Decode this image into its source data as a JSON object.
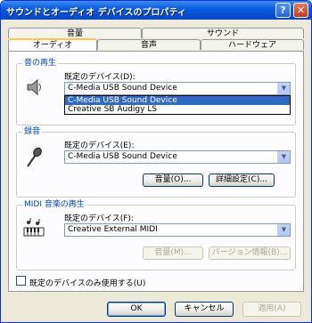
{
  "window": {
    "title": "サウンドとオーディオ デバイスのプロパティ",
    "help_glyph": "?",
    "close_glyph": "✕"
  },
  "tabs": {
    "row1": [
      "音量",
      "サウンド"
    ],
    "row2": [
      "オーディオ",
      "音声",
      "ハードウェア"
    ],
    "active": "オーディオ"
  },
  "playback": {
    "group_label": "音の再生",
    "default_device_label": "既定のデバイス(D):",
    "selected": "C-Media USB Sound Device",
    "dropdown_open": true,
    "options": [
      "C-Media USB Sound Device",
      "Creative SB Audigy LS"
    ],
    "highlighted_option": "C-Media USB Sound Device"
  },
  "recording": {
    "group_label": "録音",
    "default_device_label": "既定のデバイス(E):",
    "selected": "C-Media USB Sound Device",
    "volume_button": "音量(O)...",
    "advanced_button": "詳細設定(C)..."
  },
  "midi": {
    "group_label": "MIDI 音楽の再生",
    "default_device_label": "既定のデバイス(F):",
    "selected": "Creative External MIDI",
    "volume_button": "音量(M)...",
    "version_button": "バージョン情報(B)..."
  },
  "use_default_only": {
    "label": "既定のデバイスのみ使用する(U)",
    "checked": false
  },
  "footer": {
    "ok": "OK",
    "cancel": "キャンセル",
    "apply": "適用(A)"
  },
  "colors": {
    "titlebar": "#0a5de0",
    "group_label": "#0046d5",
    "selection": "#316ac5",
    "active_tab_accent": "#ffc73c"
  }
}
